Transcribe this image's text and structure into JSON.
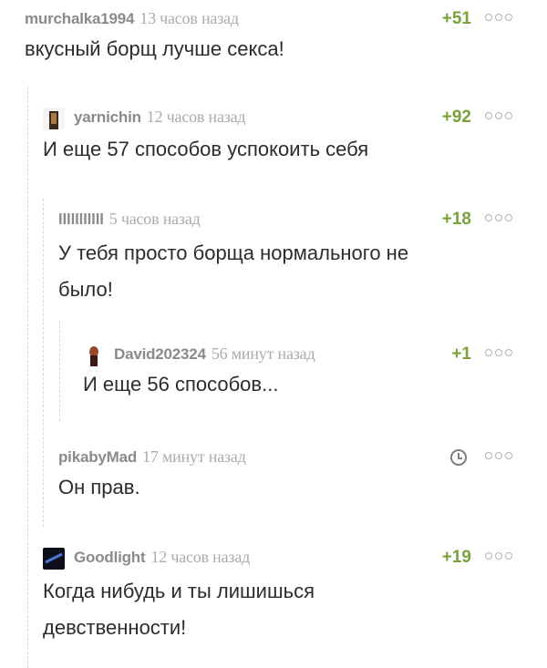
{
  "comments": [
    {
      "author": "murchalka1994",
      "time": "13 часов назад",
      "rating": "+51",
      "text": "вкусный борщ лучше секса!"
    },
    {
      "author": "yarnichin",
      "time": "12 часов назад",
      "rating": "+92",
      "text": "И еще 57 способов успокоить себя"
    },
    {
      "author": "lllllllllll",
      "time": "5 часов назад",
      "rating": "+18",
      "text_lines": [
        "У тебя просто борща нормального не",
        "было!"
      ]
    },
    {
      "author": "David202324",
      "time": "56 минут назад",
      "rating": "+1",
      "text": "И еще 56 способов..."
    },
    {
      "author": "pikabyMad",
      "time": "17 минут назад",
      "text": "Он прав."
    },
    {
      "author": "Goodlight",
      "time": "12 часов назад",
      "rating": "+19",
      "text_lines": [
        "Когда нибудь и ты лишишься",
        "девственности!"
      ]
    }
  ],
  "icons": {
    "more": "more-dots-icon",
    "clock": "clock-icon"
  },
  "colors": {
    "rating": "#7aa23c",
    "author": "#8a8a8a",
    "thread_line": "#d8d8d8"
  }
}
